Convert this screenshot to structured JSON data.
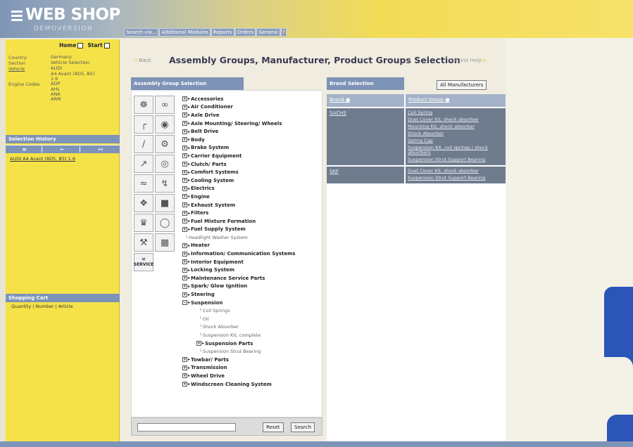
{
  "header": {
    "logo": "WEB SHOP",
    "demo": "DEMOVERSION",
    "nav": [
      "Search via...",
      "Additional Modules",
      "Reports",
      "Orders",
      "General",
      "?"
    ]
  },
  "sidebar": {
    "home_label": "Home",
    "start_label": "Start",
    "info": [
      {
        "key": "Country",
        "value": "Germany"
      },
      {
        "key": "Section",
        "value": "Vehicle Selection"
      },
      {
        "key": "Vehicle",
        "value": "AUDI"
      },
      {
        "key": "",
        "value": "A4 Avant (8D5, B5)"
      },
      {
        "key": "",
        "value": "1.6"
      },
      {
        "key": "Engine Codes",
        "value": "ADP"
      },
      {
        "key": "",
        "value": "AHL"
      },
      {
        "key": "",
        "value": "ANA"
      },
      {
        "key": "",
        "value": "ARM"
      }
    ],
    "history_title": "Selection History",
    "history_link": "AUDI A4 Avant (8D5, B5) 1.6",
    "cart_title": "Shopping Cart",
    "cart_header": "Quantity | Number | Article"
  },
  "main": {
    "back_label": "Back",
    "title": "Assembly Groups, Manufacturer, Product Groups Selection",
    "context_help": "Context Help",
    "assembly_head": "Assembly Group Selection",
    "brand_head": "Brand Selection",
    "all_manufacturers": "All Manufacturers",
    "service_label": "SERVICE",
    "tree": [
      {
        "label": "Accessories",
        "type": "group"
      },
      {
        "label": "Air Conditioner",
        "type": "group"
      },
      {
        "label": "Axle Drive",
        "type": "group"
      },
      {
        "label": "Axle Mounting/ Steering/ Wheels",
        "type": "group"
      },
      {
        "label": "Belt Drive",
        "type": "group"
      },
      {
        "label": "Body",
        "type": "group"
      },
      {
        "label": "Brake System",
        "type": "group"
      },
      {
        "label": "Carrier Equipment",
        "type": "group"
      },
      {
        "label": "Clutch/ Parts",
        "type": "group"
      },
      {
        "label": "Comfort Systems",
        "type": "group"
      },
      {
        "label": "Cooling System",
        "type": "group"
      },
      {
        "label": "Electrics",
        "type": "group"
      },
      {
        "label": "Engine",
        "type": "group"
      },
      {
        "label": "Exhaust System",
        "type": "group"
      },
      {
        "label": "Filters",
        "type": "group"
      },
      {
        "label": "Fuel Mixture Formation",
        "type": "group"
      },
      {
        "label": "Fuel Supply System",
        "type": "group"
      },
      {
        "label": "Headlight Washer System",
        "type": "leaf"
      },
      {
        "label": "Heater",
        "type": "group"
      },
      {
        "label": "Information/ Communication Systems",
        "type": "group"
      },
      {
        "label": "Interior Equipment",
        "type": "group"
      },
      {
        "label": "Locking System",
        "type": "group"
      },
      {
        "label": "Maintenance Service Parts",
        "type": "group"
      },
      {
        "label": "Spark/ Glow Ignition",
        "type": "group"
      },
      {
        "label": "Steering",
        "type": "group"
      },
      {
        "label": "Suspension",
        "type": "open"
      },
      {
        "label": "Coil Springs",
        "type": "sub"
      },
      {
        "label": "Oil",
        "type": "sub"
      },
      {
        "label": "Shock Absorber",
        "type": "sub"
      },
      {
        "label": "Suspension Kit, complete",
        "type": "sub"
      },
      {
        "label": "Suspension Parts",
        "type": "subgroup"
      },
      {
        "label": "Suspension Strut Bearing",
        "type": "sub"
      },
      {
        "label": "Towbar/ Parts",
        "type": "group"
      },
      {
        "label": "Transmission",
        "type": "group"
      },
      {
        "label": "Wheel Drive",
        "type": "group"
      },
      {
        "label": "Windscreen Cleaning System",
        "type": "group"
      }
    ],
    "reset_label": "Reset",
    "search_label": "Search",
    "brand_col": "Brand",
    "product_col": "Product Group",
    "brands": [
      {
        "name": "SACHS",
        "groups": [
          "Coil Spring",
          "Dust Cover Kit, shock absorber",
          "Mounting Kit, shock absorber",
          "Shock Absorber",
          "Spring Cap",
          "Suspension Kit, coil springs / shock absorbers",
          "Suspension Strut Support Bearing"
        ]
      },
      {
        "name": "SKF",
        "groups": [
          "Dust Cover Kit, shock absorber",
          "Suspension Strut Support Bearing"
        ]
      }
    ]
  },
  "colors": {
    "sidebar_yellow": "#f5e248",
    "panel_blue": "#7d93b7",
    "brand_dark": "#6f7c8e",
    "deco_blue": "#2c55b8"
  }
}
